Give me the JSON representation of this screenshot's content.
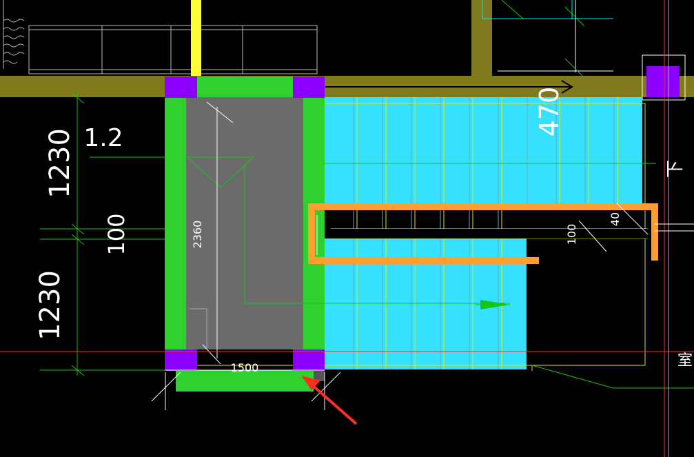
{
  "drawing": {
    "colors": {
      "background": "#000000",
      "wall": "#807a1c",
      "column": "#8c00ff",
      "beam": "#2ed12e",
      "landing": "#6b6b6b",
      "stair_steps": "#36e0ff",
      "rebar": "#ff9d2e",
      "annotation": "#ff2e20",
      "dimension_line": "#16c616",
      "yellow_line": "#e6e600"
    },
    "dimensions": {
      "left_top": "1230",
      "left_middle": "100",
      "left_bottom": "1230",
      "slope": "1.2",
      "landing_height": "2360",
      "landing_width": "1500",
      "top_right": "470",
      "slab_thickness": "100",
      "slab_offset": "40"
    },
    "labels": {
      "down": "下",
      "room_partial": "室|"
    },
    "icons": {
      "direction_arrow": "arrow-right-icon",
      "green_arrow": "green-arrow-icon",
      "red_pointer": "red-pointer-arrow-icon"
    }
  }
}
